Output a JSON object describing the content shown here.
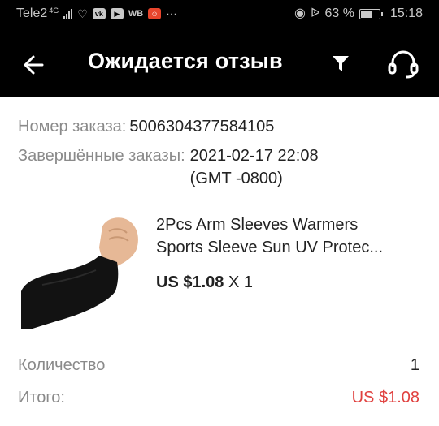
{
  "status_bar": {
    "carrier": "Tele2",
    "network": "4G",
    "battery_percent": "63 %",
    "time": "15:18",
    "icons": [
      "signal-icon",
      "heart-icon",
      "vk-icon",
      "youtube-icon",
      "wb-icon",
      "aliexpress-icon",
      "more-icon",
      "eye-icon",
      "bluetooth-icon",
      "battery-icon"
    ]
  },
  "app_bar": {
    "title": "Ожидается отзыв",
    "icons": [
      "back-arrow-icon",
      "filter-icon",
      "headset-icon"
    ]
  },
  "order": {
    "number_label": "Номер заказа:",
    "number_value": "5006304377584105",
    "completed_label": "Завершённые заказы:",
    "completed_date": "2021-02-17 22:08",
    "completed_tz": "(GMT -0800)"
  },
  "product": {
    "title_line1": "2Pcs Arm Sleeves Warmers",
    "title_line2": "Sports Sleeve Sun UV Protec...",
    "price": "US $1.08",
    "quantity": "X 1",
    "image": "arm-sleeve-image"
  },
  "summary": {
    "quantity_label": "Количество",
    "quantity_value": "1",
    "total_label": "Итого:",
    "total_value": "US $1.08"
  },
  "colors": {
    "header_bg": "#000000",
    "accent_red": "#e0413f"
  }
}
